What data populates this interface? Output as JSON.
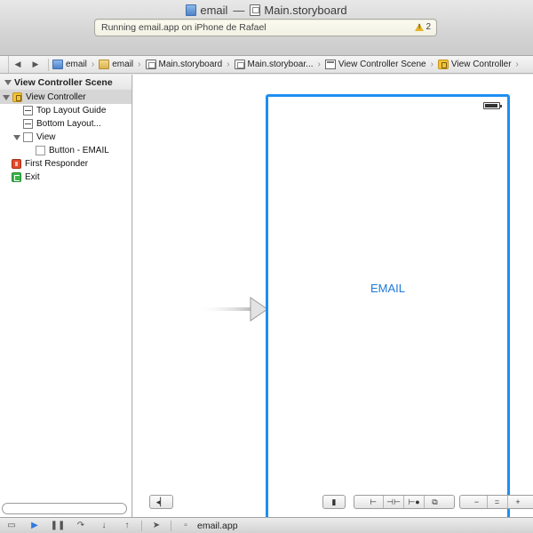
{
  "window": {
    "project_name": "email",
    "separator": "—",
    "file_name": "Main.storyboard"
  },
  "activity": {
    "status_text": "Running email.app on iPhone de Rafael",
    "warning_count": "2",
    "warning_color": "#e6b52a"
  },
  "jumpbar": {
    "back_icon": "chevron-left-icon",
    "forward_icon": "chevron-right-icon",
    "crumbs": [
      {
        "label": "email",
        "icon": "project-icon"
      },
      {
        "label": "email",
        "icon": "folder-icon"
      },
      {
        "label": "Main.storyboard",
        "icon": "storyboard-icon"
      },
      {
        "label": "Main.storyboar...",
        "icon": "storyboard-icon"
      },
      {
        "label": "View Controller Scene",
        "icon": "scene-icon"
      },
      {
        "label": "View Controller",
        "icon": "view-controller-icon"
      }
    ]
  },
  "outline": {
    "header": "View Controller Scene",
    "items": [
      {
        "label": "View Controller"
      },
      {
        "label": "Top Layout Guide"
      },
      {
        "label": "Bottom Layout..."
      },
      {
        "label": "View"
      },
      {
        "label": "Button - EMAIL"
      },
      {
        "label": "First Responder"
      },
      {
        "label": "Exit"
      }
    ]
  },
  "canvas": {
    "email_button_label": "EMAIL",
    "frame_color": "#1d8ff2",
    "button_color": "#1c7ad9"
  },
  "debug": {
    "target_label": "email.app"
  }
}
